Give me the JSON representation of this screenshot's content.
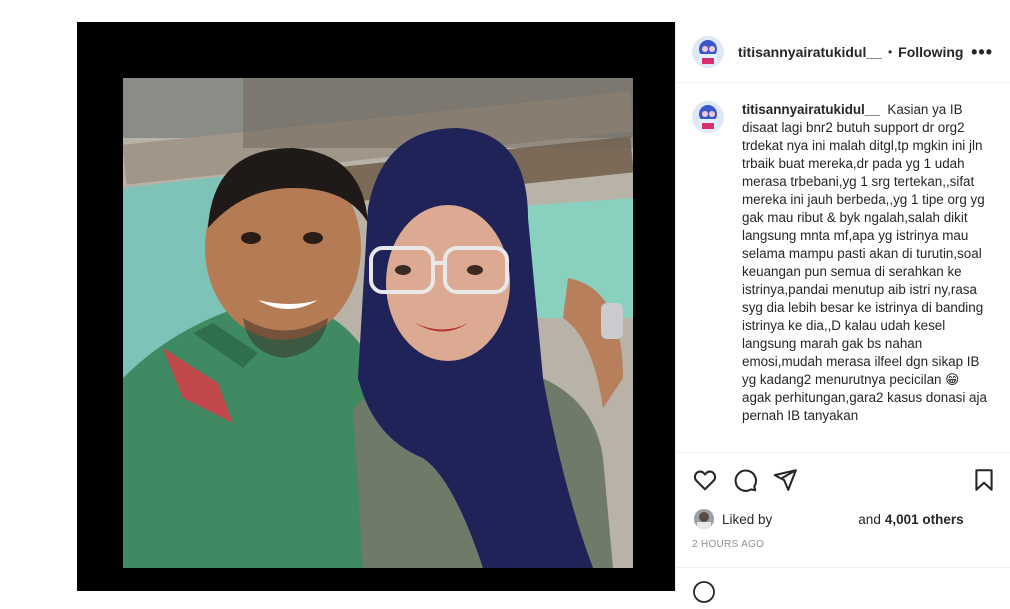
{
  "post": {
    "username": "titisannyairatukidul__",
    "follow_separator": "•",
    "follow_status": "Following",
    "more_options": "•••"
  },
  "caption": {
    "username": "titisannyairatukidul__",
    "text": "Kasian ya IB disaat lagi bnr2 butuh support dr org2 trdekat nya ini malah ditgl,tp mgkin ini jln trbaik buat mereka,dr pada yg 1 udah merasa trbebani,yg 1 srg tertekan,,sifat mereka ini jauh berbeda,,yg 1 tipe org yg gak mau ribut & byk ngalah,salah dikit langsung mnta mf,apa yg istrinya mau selama mampu pasti akan di turutin,soal keuangan pun semua di serahkan ke istrinya,pandai menutup aib istri ny,rasa syg dia lebih besar ke istrinya di banding istrinya ke dia,,D kalau udah kesel langsung marah gak bs nahan emosi,mudah merasa ilfeel dgn sikap IB yg kadang2 menurutnya pecicilan 😁 agak perhitungan,gara2 kasus donasi aja pernah IB tanyakan"
  },
  "likes": {
    "prefix": "Liked by",
    "suffix": "and",
    "count": "4,001 others"
  },
  "timestamp": "2 HOURS AGO",
  "icons": {
    "like": "heart-icon",
    "comment": "comment-icon",
    "share": "share-icon",
    "save": "bookmark-icon",
    "emoji": "emoji-icon"
  },
  "colors": {
    "media_background": "#000000",
    "border": "#efefef",
    "muted": "#8e8e8e"
  }
}
